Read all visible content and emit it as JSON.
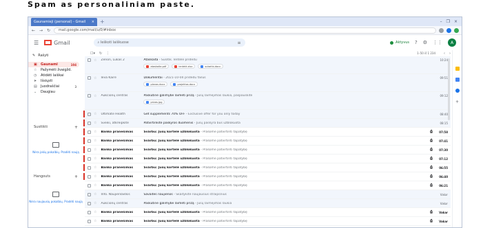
{
  "slide": {
    "title": "Spam as personaliniam paste."
  },
  "browser": {
    "tab_title": "Gaunamieji (personal) - Gmail",
    "tab_close": "×",
    "tab_new": "+",
    "win_controls": [
      "–",
      "❐",
      "×"
    ],
    "url": "mail.google.com/mail/u/0/#inbox"
  },
  "gmail": {
    "logo_text": "Gmail",
    "search_placeholder": "Ieškoti laiškuose",
    "status": "Aktyvus",
    "avatar_letter": "A"
  },
  "sidebar": {
    "compose": "Rašyti",
    "items": [
      {
        "label": "Gaunami",
        "count": "104",
        "active": true
      },
      {
        "label": "Pažymėti žvaigžd.",
        "count": ""
      },
      {
        "label": "Atidėti laiškai",
        "count": ""
      },
      {
        "label": "Išsiųsti",
        "count": ""
      },
      {
        "label": "Juodraščiai",
        "count": "3"
      },
      {
        "label": "Daugiau",
        "count": ""
      }
    ],
    "section1": "Susitikti",
    "section1_empty": "Nėra jokių pokalbių. Pradėti naują",
    "section2": "Hangouts",
    "section2_empty": "Nėra naujausių pokalbių. Pradėti naują"
  },
  "toolbar": {
    "pager": "1–50 iš 1 234"
  },
  "rows": [
    {
      "sender": "Zenon, Lukas 2",
      "subject": "Ataskaita",
      "snippet": " - Susitik. lentelė pridedu",
      "date": "10:24",
      "state": "read",
      "flag": false,
      "chips": [
        {
          "label": "ataskaita.pdf",
          "kind": "r"
        },
        {
          "label": "lentelė.xlsx",
          "kind": "r"
        },
        {
          "label": "sutartis.docx",
          "kind": "b"
        }
      ],
      "tall": true
    },
    {
      "sender": "Ieva Kairė",
      "subject": "Dokumentai",
      "snippet": " - 2021-10-04 pridedu failus",
      "date": "09:51",
      "state": "read",
      "flag": false,
      "chips": [
        {
          "label": "planas.docx",
          "kind": "b"
        },
        {
          "label": "projektas.docx",
          "kind": "b"
        }
      ],
      "tall": true
    },
    {
      "sender": "Aukcionų centras",
      "subject": "Paskutinė galimybė laimėti prizą",
      "snippet": " - Jūsų laimėjimas laukia, paspauskite",
      "date": "09:12",
      "state": "read",
      "flag": false,
      "chips": [
        {
          "label": "prizas.jpg",
          "kind": "b"
        }
      ],
      "tall": true
    },
    {
      "sender": "Ultimate Health",
      "subject": "Get supplements 70% OFF",
      "snippet": " - Exclusive offer for you only today",
      "date": "08:40",
      "state": "read",
      "flag": true,
      "chips": [],
      "tall": false
    },
    {
      "sender": "Sveiki, atkreipkite",
      "subject": "Patvirtinkite paskyros duomenis",
      "snippet": " - Jūsų paskyra bus užblokuota",
      "date": "08:15",
      "state": "read",
      "flag": true,
      "chips": [],
      "tall": false
    },
    {
      "sender": "Banko pranešimas",
      "subject": "Svarbu: Jūsų kortelė užblokuota",
      "snippet": " - Prašome patvirtinti tapatybę",
      "date": "07:58",
      "state": "unread",
      "flag": true,
      "chips": [],
      "tall": false
    },
    {
      "sender": "Banko pranešimas",
      "subject": "Svarbu: Jūsų kortelė užblokuota",
      "snippet": " - Prašome patvirtinti tapatybę",
      "date": "07:41",
      "state": "unread",
      "flag": true,
      "chips": [],
      "tall": false
    },
    {
      "sender": "Banko pranešimas",
      "subject": "Svarbu: Jūsų kortelė užblokuota",
      "snippet": " - Prašome patvirtinti tapatybę",
      "date": "07:30",
      "state": "unread",
      "flag": true,
      "chips": [],
      "tall": false
    },
    {
      "sender": "Banko pranešimas",
      "subject": "Svarbu: Jūsų kortelė užblokuota",
      "snippet": " - Prašome patvirtinti tapatybę",
      "date": "07:12",
      "state": "unread",
      "flag": true,
      "chips": [],
      "tall": false
    },
    {
      "sender": "Banko pranešimas",
      "subject": "Svarbu: Jūsų kortelė užblokuota",
      "snippet": " - Prašome patvirtinti tapatybę",
      "date": "06:55",
      "state": "unread",
      "flag": true,
      "chips": [],
      "tall": false
    },
    {
      "sender": "Banko pranešimas",
      "subject": "Svarbu: Jūsų kortelė užblokuota",
      "snippet": " - Prašome patvirtinti tapatybę",
      "date": "06:40",
      "state": "unread",
      "flag": true,
      "chips": [],
      "tall": false
    },
    {
      "sender": "Banko pranešimas",
      "subject": "Svarbu: Jūsų kortelė užblokuota",
      "snippet": " - Prašome patvirtinti tapatybę",
      "date": "06:21",
      "state": "unread",
      "flag": false,
      "chips": [],
      "tall": false
    },
    {
      "sender": "Info. Naujienlaiškis",
      "subject": "Savaitės naujienos",
      "snippet": " - Skaitykite naujausius straipsnius",
      "date": "Vakar",
      "state": "read",
      "flag": false,
      "chips": [],
      "tall": false
    },
    {
      "sender": "Aukcionų centras",
      "subject": "Paskutinė galimybė laimėti prizą",
      "snippet": " - Jūsų laimėjimas laukia",
      "date": "Vakar",
      "state": "read",
      "flag": false,
      "chips": [],
      "tall": false
    },
    {
      "sender": "Banko pranešimas",
      "subject": "Svarbu: Jūsų kortelė užblokuota",
      "snippet": " - Prašome patvirtinti tapatybę",
      "date": "Vakar",
      "state": "unread",
      "flag": false,
      "chips": [],
      "tall": false
    },
    {
      "sender": "Banko pranešimas",
      "subject": "Svarbu: Jūsų kortelė užblokuota",
      "snippet": " - Prašome patvirtinti tapatybę",
      "date": "Vakar",
      "state": "unread",
      "flag": false,
      "chips": [],
      "tall": false
    }
  ]
}
